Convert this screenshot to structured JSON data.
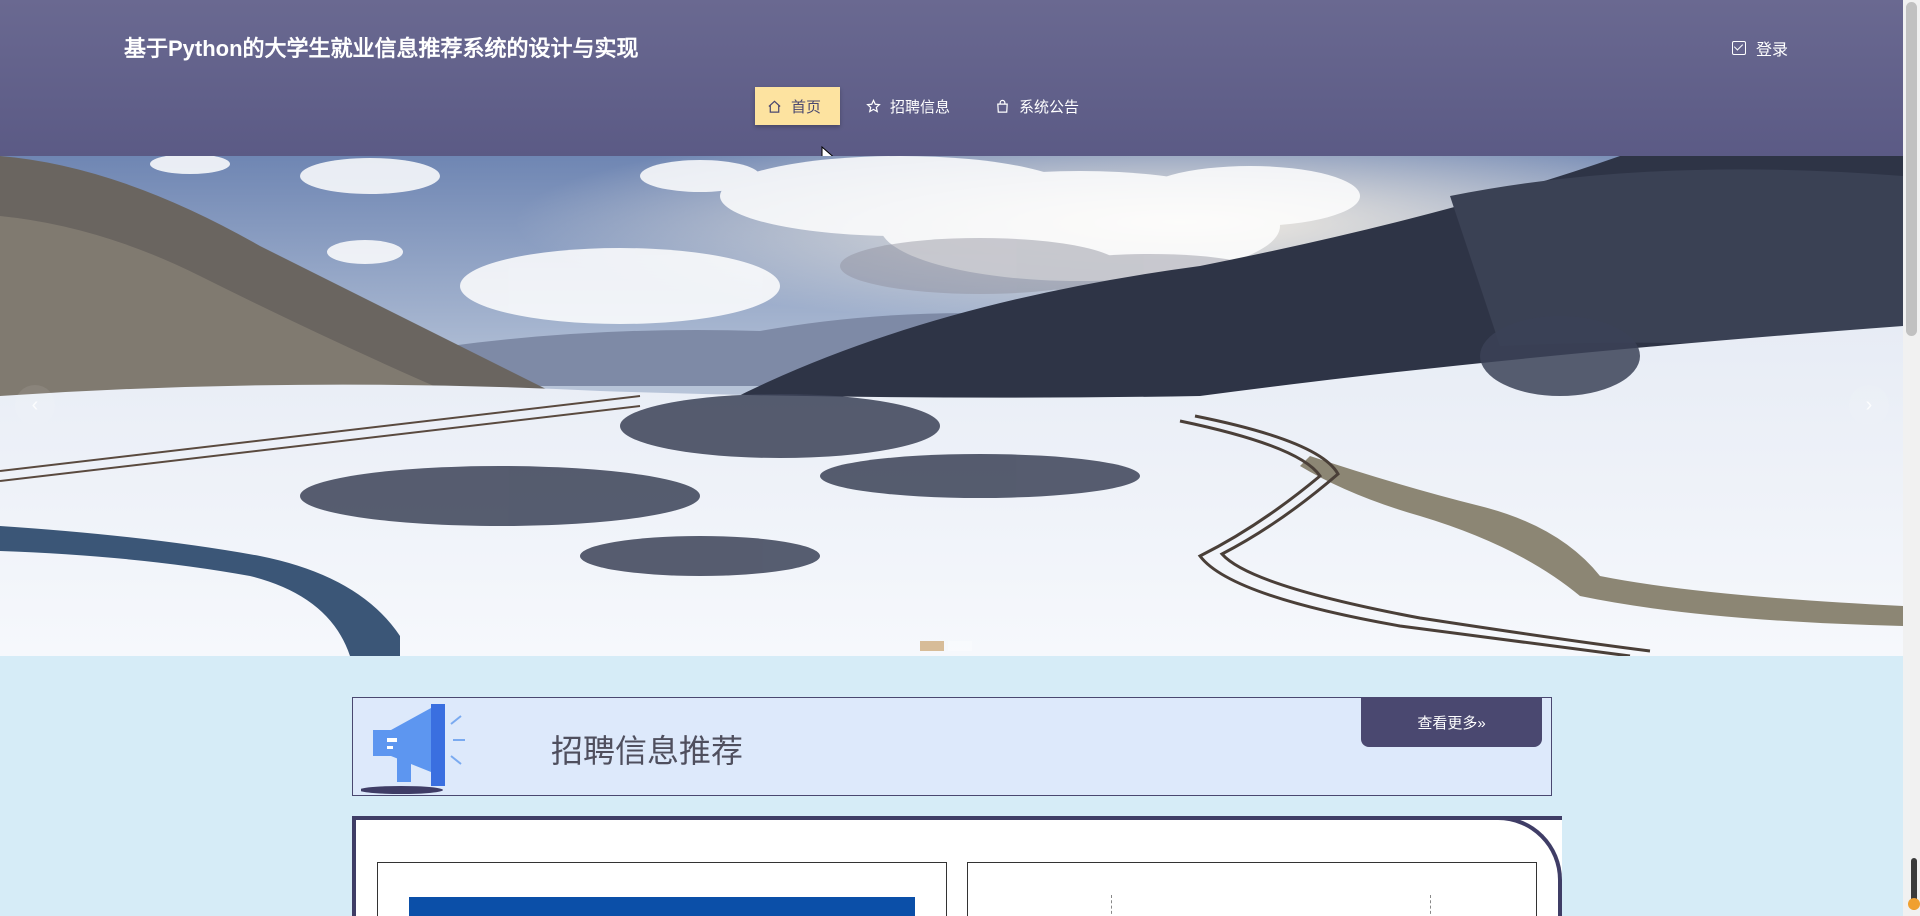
{
  "header": {
    "site_title": "基于Python的大学生就业信息推荐系统的设计与实现",
    "login_label": "登录"
  },
  "nav": {
    "items": [
      {
        "label": "首页",
        "icon": "home-icon",
        "active": true
      },
      {
        "label": "招聘信息",
        "icon": "star-icon",
        "active": false
      },
      {
        "label": "系统公告",
        "icon": "bag-icon",
        "active": false
      }
    ]
  },
  "banner": {
    "slide_count": 2,
    "active_slide": 0
  },
  "section": {
    "title": "招聘信息推荐",
    "more_label": "查看更多»"
  },
  "colors": {
    "header_bg": "#5f5e88",
    "active_nav": "#fde3a0",
    "accent": "#4a4870",
    "page_bg": "#d6ecf7"
  }
}
